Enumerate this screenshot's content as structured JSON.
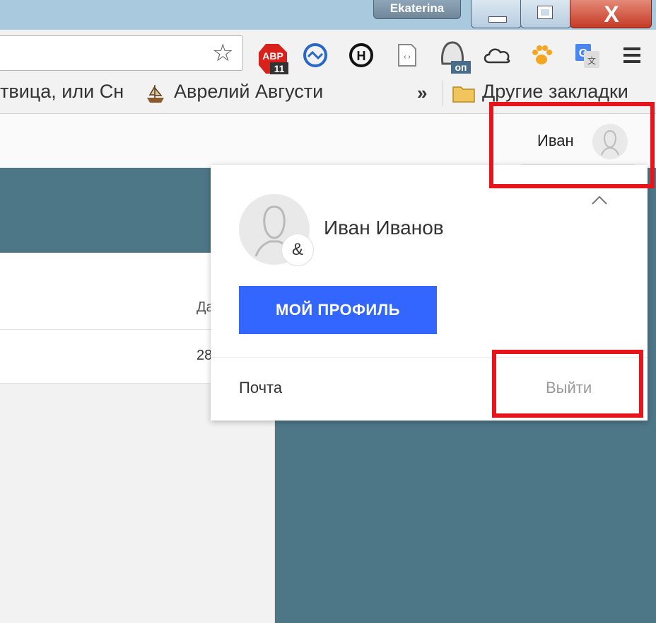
{
  "window": {
    "user_name": "Ekaterina",
    "close_symbol": "X",
    "buttons": [
      "minimize-icon",
      "restore-icon",
      "close-icon"
    ]
  },
  "toolbar": {
    "extensions": [
      "abp-icon",
      "sync-icon",
      "h-extension-icon",
      "source-code-icon",
      "turbo-icon",
      "cloud-icon",
      "paw-icon",
      "translate-icon",
      "menu-icon"
    ],
    "abp_text": "ABP",
    "abp_count": "11",
    "h_letter": "H",
    "turbo_badge": "оп",
    "translate_letter": "G"
  },
  "bookmarks": {
    "item1": "твица, или Сн",
    "item2": "Аврелий Августи",
    "overflow": "»",
    "other": "Другие закладки"
  },
  "header": {
    "user_short": "Иван"
  },
  "content": {
    "column_header": "Да",
    "row_value": "28"
  },
  "popup": {
    "full_name": "Иван Иванов",
    "avatar_badge": "&",
    "profile_button": "МОЙ ПРОФИЛЬ",
    "mail_link": "Почта",
    "logout_link": "Выйти"
  },
  "colors": {
    "accent": "#3366ff",
    "highlight": "#e8141c",
    "page_bg": "#4d7687"
  }
}
